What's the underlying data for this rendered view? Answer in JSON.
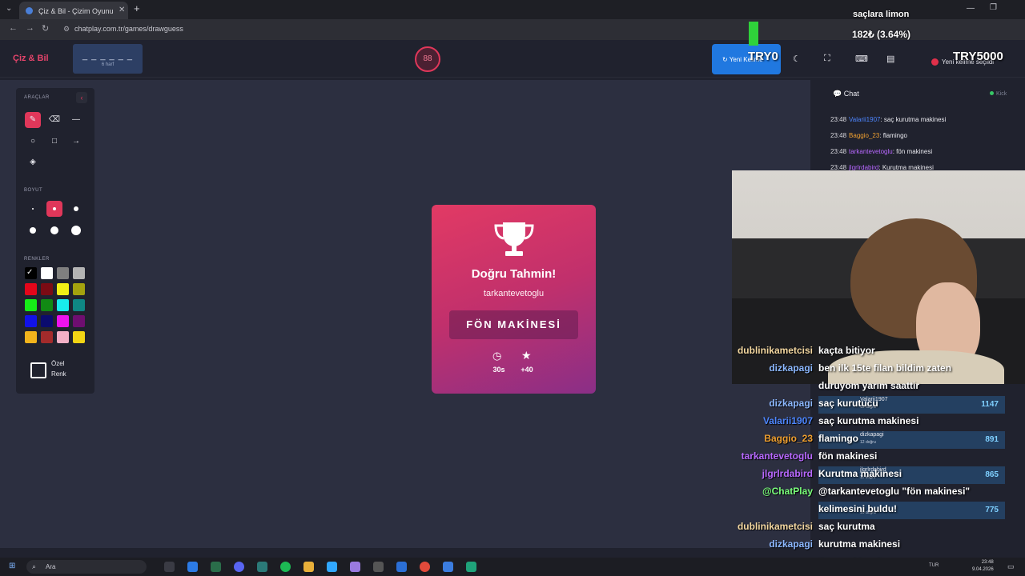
{
  "browser": {
    "tab_title": "Çiz & Bil - Çizim Oyunu",
    "url": "chatplay.com.tr/games/drawguess"
  },
  "header": {
    "logo": "Çiz & Bil",
    "word_hint": "_ _ _ _ _ _",
    "word_length": "6 harf",
    "timer": "88",
    "new_word_label": "Yeni Kelime",
    "notice": "Yeni kelime seçildi"
  },
  "tools": {
    "tools_title": "ARAÇLAR",
    "size_title": "BOYUT",
    "colors_title": "RENKLER",
    "custom_color_label": "Özel",
    "custom_color_label2": "Renk",
    "colors": [
      "#000000",
      "#ffffff",
      "#7f7f7f",
      "#b4b4b4",
      "#e3061a",
      "#7b0b14",
      "#f1ee16",
      "#a4a20e",
      "#16ed17",
      "#118a14",
      "#18ecec",
      "#0f8784",
      "#1212e8",
      "#0b0b6e",
      "#ee12ee",
      "#6f0e70",
      "#f2b41c",
      "#a32b2b",
      "#f2b0c6",
      "#f2d514"
    ]
  },
  "result": {
    "title": "Doğru Tahmin!",
    "user": "tarkantevetoglu",
    "word": "FÖN MAKİNESİ",
    "time": "30s",
    "points": "+40"
  },
  "chat": {
    "title": "Chat",
    "kick_label": "Kick",
    "messages": [
      {
        "time": "23:48",
        "user": "Valarii1907",
        "text": ": saç kurutma makinesi",
        "color": "#4d86ff"
      },
      {
        "time": "23:48",
        "user": "Baggio_23",
        "text": ": flamingo",
        "color": "#f0a030"
      },
      {
        "time": "23:48",
        "user": "tarkantevetoglu",
        "text": ": fön makinesi",
        "color": "#b868ff"
      },
      {
        "time": "23:48",
        "user": "jlgrlrdabird",
        "text": ": Kurutma makinesi",
        "color": "#b868ff"
      }
    ]
  },
  "overlay": {
    "song": "saçlara limon",
    "price": "182₺ (3.64%)",
    "try0": "TRY0",
    "try5000": "TRY5000",
    "bigchat": [
      {
        "user": "dublinikametcisi",
        "text": "kaçta bitiyor",
        "color": "#f3d7a0"
      },
      {
        "user": "dizkapagi",
        "text": "ben ilk 15te filan bildim zaten",
        "color": "#8cb8ff"
      },
      {
        "user": "",
        "text": "duruyom yarım saattir",
        "color": "#8cb8ff"
      },
      {
        "user": "dizkapagi",
        "text": "saç kurutucu",
        "color": "#8cb8ff"
      },
      {
        "user": "Valarii1907",
        "text": "saç kurutma makinesi",
        "color": "#4d86ff"
      },
      {
        "user": "Baggio_23",
        "text": "flamingo",
        "color": "#f0a030"
      },
      {
        "user": "tarkantevetoglu",
        "text": "fön makinesi",
        "color": "#b868ff"
      },
      {
        "user": "jlgrlrdabird",
        "text": "Kurutma makinesi",
        "color": "#b868ff"
      },
      {
        "user": "@ChatPlay",
        "text": "@tarkantevetoglu \"fön makinesi\"",
        "color": "#7aff7a"
      },
      {
        "user": "",
        "text": "kelimesini buldu!",
        "color": "#7aff7a"
      },
      {
        "user": "dublinikametcisi",
        "text": "saç kurutma",
        "color": "#f3d7a0"
      },
      {
        "user": "dizkapagi",
        "text": "kurutma makinesi",
        "color": "#8cb8ff"
      },
      {
        "user": "jlgrlrdabird",
        "text": "Fön makinesi",
        "color": "#b868ff"
      }
    ],
    "leaderboard": [
      {
        "name": "Valarii1907",
        "sub": "15 doğru",
        "points": "1147"
      },
      {
        "name": "dizkapagi",
        "sub": "12 doğru",
        "points": "891"
      },
      {
        "name": "jlgrlrdabird",
        "sub": "11 doğru",
        "points": "865"
      },
      {
        "name": "",
        "sub": "10 doğru",
        "points": "775"
      }
    ]
  },
  "taskbar": {
    "search_placeholder": "Ara",
    "lang": "TUR",
    "time": "23:48",
    "date": "9.04.2026"
  }
}
